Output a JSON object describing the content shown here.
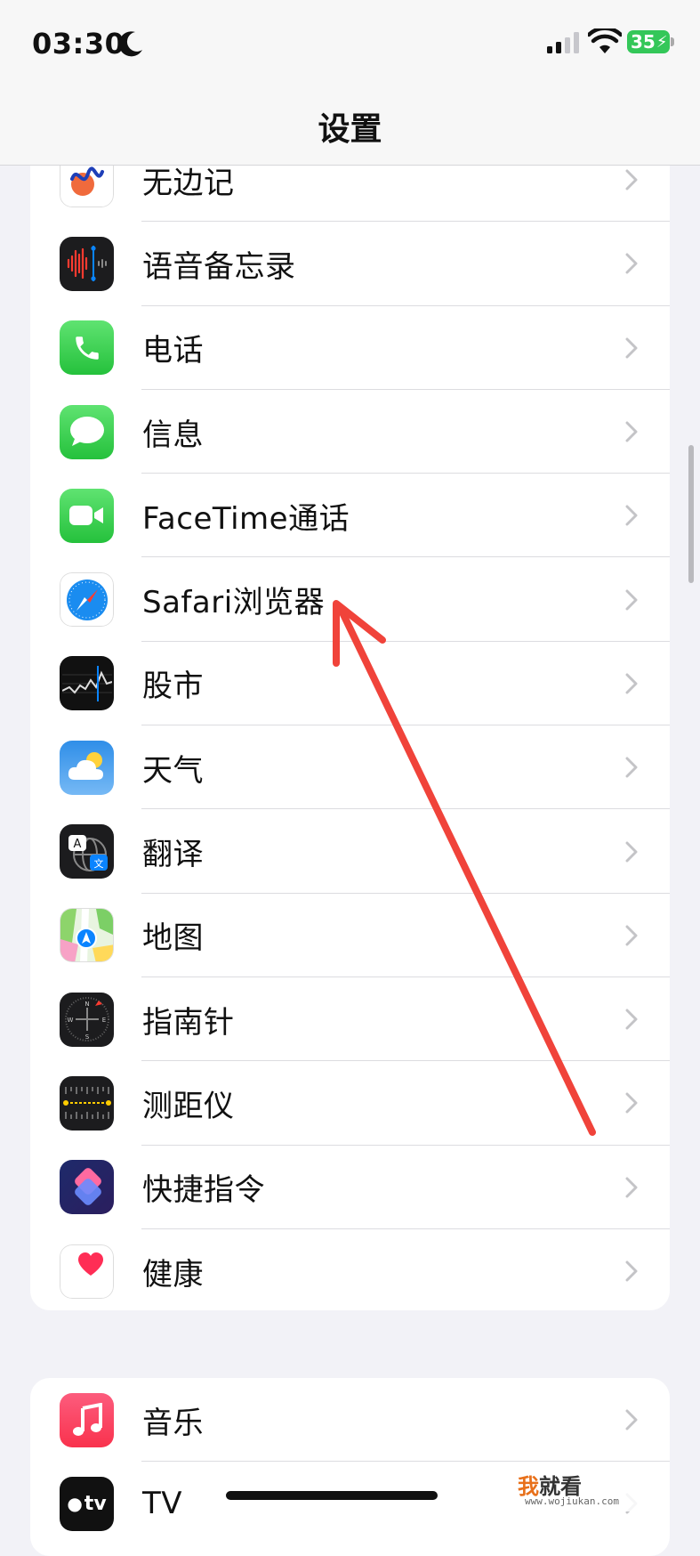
{
  "status_bar": {
    "time": "03:30",
    "battery": "35",
    "icons": [
      "moon-icon",
      "cellular-signal-icon",
      "wifi-icon",
      "battery-charging-icon"
    ]
  },
  "nav": {
    "title": "设置"
  },
  "group1": {
    "items": [
      {
        "label": "无边记",
        "icon": "freeform-icon"
      },
      {
        "label": "语音备忘录",
        "icon": "voice-memos-icon"
      },
      {
        "label": "电话",
        "icon": "phone-icon"
      },
      {
        "label": "信息",
        "icon": "messages-icon"
      },
      {
        "label": "FaceTime通话",
        "icon": "facetime-icon"
      },
      {
        "label": "Safari浏览器",
        "icon": "safari-icon"
      },
      {
        "label": "股市",
        "icon": "stocks-icon"
      },
      {
        "label": "天气",
        "icon": "weather-icon"
      },
      {
        "label": "翻译",
        "icon": "translate-icon"
      },
      {
        "label": "地图",
        "icon": "maps-icon"
      },
      {
        "label": "指南针",
        "icon": "compass-icon"
      },
      {
        "label": "测距仪",
        "icon": "measure-icon"
      },
      {
        "label": "快捷指令",
        "icon": "shortcuts-icon"
      },
      {
        "label": "健康",
        "icon": "health-icon"
      }
    ]
  },
  "group2": {
    "items": [
      {
        "label": "音乐",
        "icon": "music-icon"
      },
      {
        "label": "TV",
        "icon": "apple-tv-icon"
      }
    ]
  },
  "watermark": {
    "main_a": "我",
    "main_b": "就看",
    "sub": "www.wojiukan.com"
  },
  "colors": {
    "annotation_arrow": "#f0433a",
    "accent_green": "#34c759",
    "background": "#f2f2f7"
  }
}
